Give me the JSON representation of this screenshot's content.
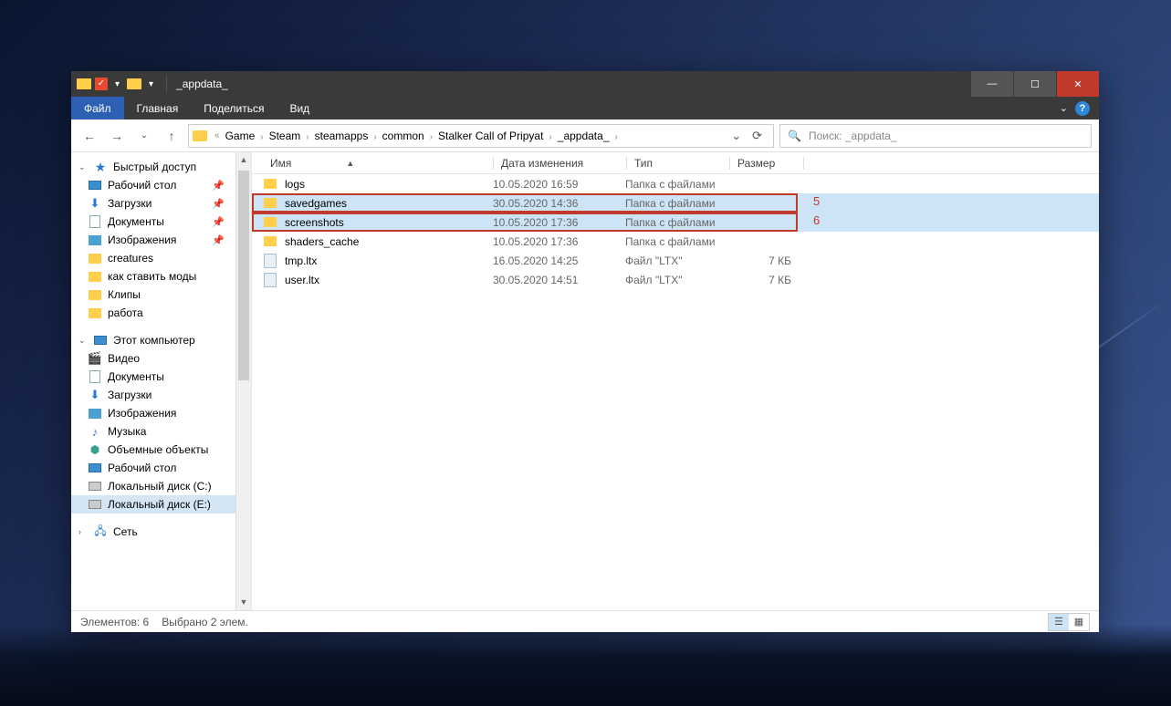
{
  "window": {
    "title": "_appdata_"
  },
  "ribbon": {
    "file": "Файл",
    "home": "Главная",
    "share": "Поделиться",
    "view": "Вид"
  },
  "breadcrumb": {
    "items": [
      "Game",
      "Steam",
      "steamapps",
      "common",
      "Stalker Call of Pripyat",
      "_appdata_"
    ]
  },
  "search": {
    "placeholder": "Поиск: _appdata_"
  },
  "sidebar": {
    "quick_access": "Быстрый доступ",
    "desktop": "Рабочий стол",
    "downloads": "Загрузки",
    "documents": "Документы",
    "pictures": "Изображения",
    "creatures": "creatures",
    "mods_guide": "как ставить моды",
    "clips": "Клипы",
    "work": "работа",
    "this_pc": "Этот компьютер",
    "videos": "Видео",
    "documents2": "Документы",
    "downloads2": "Загрузки",
    "pictures2": "Изображения",
    "music": "Музыка",
    "objects3d": "Объемные объекты",
    "desktop2": "Рабочий стол",
    "disk_c": "Локальный диск (C:)",
    "disk_e": "Локальный диск (E:)",
    "network": "Сеть"
  },
  "columns": {
    "name": "Имя",
    "date": "Дата изменения",
    "type": "Тип",
    "size": "Размер"
  },
  "files": [
    {
      "name": "logs",
      "date": "10.05.2020 16:59",
      "type": "Папка с файлами",
      "size": "",
      "kind": "folder",
      "selected": false
    },
    {
      "name": "savedgames",
      "date": "30.05.2020 14:36",
      "type": "Папка с файлами",
      "size": "",
      "kind": "folder",
      "selected": true
    },
    {
      "name": "screenshots",
      "date": "10.05.2020 17:36",
      "type": "Папка с файлами",
      "size": "",
      "kind": "folder",
      "selected": true
    },
    {
      "name": "shaders_cache",
      "date": "10.05.2020 17:36",
      "type": "Папка с файлами",
      "size": "",
      "kind": "folder",
      "selected": false
    },
    {
      "name": "tmp.ltx",
      "date": "16.05.2020 14:25",
      "type": "Файл \"LTX\"",
      "size": "7 КБ",
      "kind": "ltx",
      "selected": false
    },
    {
      "name": "user.ltx",
      "date": "30.05.2020 14:51",
      "type": "Файл \"LTX\"",
      "size": "7 КБ",
      "kind": "ltx",
      "selected": false
    }
  ],
  "highlights": {
    "label1": "5",
    "label2": "6"
  },
  "status": {
    "elements": "Элементов: 6",
    "selected": "Выбрано 2 элем."
  }
}
